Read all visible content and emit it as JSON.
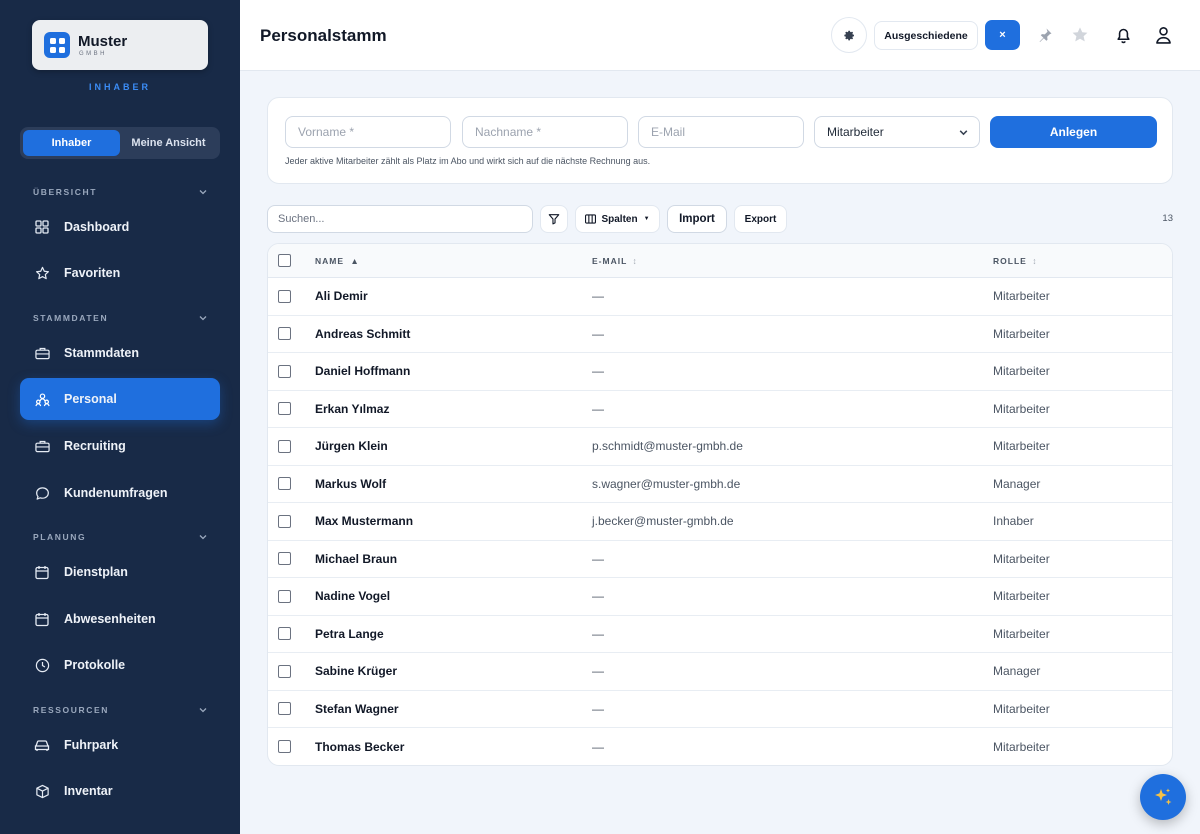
{
  "brand": {
    "name": "Muster",
    "sub": "GMBH",
    "role": "INHABER"
  },
  "view_toggle": {
    "options": [
      "Inhaber",
      "Meine Ansicht"
    ],
    "active": 0
  },
  "sidebar": {
    "sections": [
      {
        "title": "ÜBERSICHT",
        "items": [
          {
            "label": "Dashboard",
            "icon": "grid-icon"
          },
          {
            "label": "Favoriten",
            "icon": "star-icon"
          }
        ]
      },
      {
        "title": "STAMMDATEN",
        "items": [
          {
            "label": "Stammdaten",
            "icon": "briefcase-icon"
          },
          {
            "label": "Personal",
            "icon": "people-icon",
            "active": true
          },
          {
            "label": "Recruiting",
            "icon": "briefcase-icon"
          },
          {
            "label": "Kundenumfragen",
            "icon": "chat-icon"
          }
        ]
      },
      {
        "title": "PLANUNG",
        "items": [
          {
            "label": "Dienstplan",
            "icon": "calendar-icon"
          },
          {
            "label": "Abwesenheiten",
            "icon": "calendar-icon"
          },
          {
            "label": "Protokolle",
            "icon": "clock-icon"
          }
        ]
      },
      {
        "title": "RESSOURCEN",
        "items": [
          {
            "label": "Fuhrpark",
            "icon": "car-icon"
          },
          {
            "label": "Inventar",
            "icon": "box-icon"
          }
        ]
      }
    ]
  },
  "header": {
    "title": "Personalstamm",
    "retired_label": "Ausgeschiedene",
    "close_label": "×"
  },
  "create_form": {
    "firstname_placeholder": "Vorname *",
    "lastname_placeholder": "Nachname *",
    "email_placeholder": "E-Mail",
    "role_value": "Mitarbeiter",
    "submit_label": "Anlegen",
    "hint": "Jeder aktive Mitarbeiter zählt als Platz im Abo und wirkt sich auf die nächste Rechnung aus."
  },
  "toolbar": {
    "search_placeholder": "Suchen...",
    "columns_label": "Spalten",
    "import_label": "Import",
    "export_label": "Export",
    "count": "13"
  },
  "table": {
    "columns": [
      "NAME",
      "E-MAIL",
      "ROLLE"
    ],
    "sort_indicators": [
      "▲",
      "↕",
      "↕"
    ],
    "rows": [
      {
        "name": "Ali Demir",
        "email": "—",
        "role": "Mitarbeiter"
      },
      {
        "name": "Andreas Schmitt",
        "email": "—",
        "role": "Mitarbeiter"
      },
      {
        "name": "Daniel Hoffmann",
        "email": "—",
        "role": "Mitarbeiter"
      },
      {
        "name": "Erkan Yılmaz",
        "email": "—",
        "role": "Mitarbeiter"
      },
      {
        "name": "Jürgen Klein",
        "email": "p.schmidt@muster-gmbh.de",
        "role": "Mitarbeiter"
      },
      {
        "name": "Markus Wolf",
        "email": "s.wagner@muster-gmbh.de",
        "role": "Manager"
      },
      {
        "name": "Max Mustermann",
        "email": "j.becker@muster-gmbh.de",
        "role": "Inhaber"
      },
      {
        "name": "Michael Braun",
        "email": "—",
        "role": "Mitarbeiter"
      },
      {
        "name": "Nadine Vogel",
        "email": "—",
        "role": "Mitarbeiter"
      },
      {
        "name": "Petra Lange",
        "email": "—",
        "role": "Mitarbeiter"
      },
      {
        "name": "Sabine Krüger",
        "email": "—",
        "role": "Manager"
      },
      {
        "name": "Stefan Wagner",
        "email": "—",
        "role": "Mitarbeiter"
      },
      {
        "name": "Thomas Becker",
        "email": "—",
        "role": "Mitarbeiter"
      }
    ]
  },
  "colors": {
    "accent": "#1f6fde",
    "sidebar_bg": "#182a47",
    "page_bg": "#f1f5fb"
  }
}
